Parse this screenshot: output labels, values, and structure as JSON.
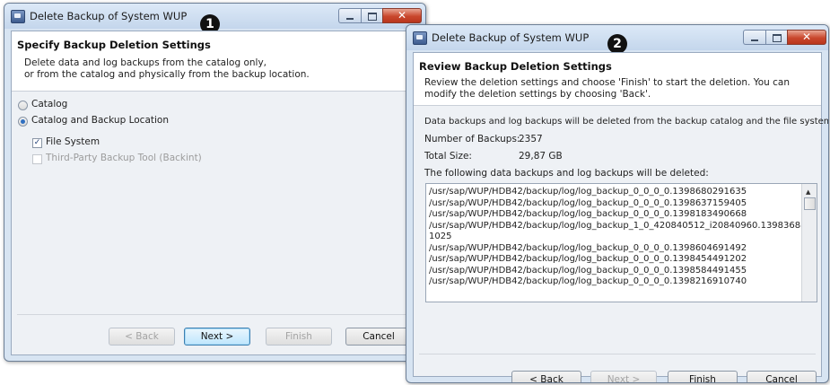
{
  "window1": {
    "title": "Delete Backup of System WUP",
    "badge": "1",
    "header_title": "Specify Backup Deletion Settings",
    "description": [
      "Delete data and log backups from the catalog only,",
      "or from the catalog and physically from the backup location."
    ],
    "radio_catalog": "Catalog",
    "radio_catalog_backup": "Catalog and Backup Location",
    "check_file_system": "File System",
    "check_third_party": "Third-Party Backup Tool (Backint)",
    "buttons": {
      "back": "< Back",
      "next": "Next >",
      "finish": "Finish",
      "cancel": "Cancel"
    }
  },
  "window2": {
    "title": "Delete Backup of System WUP",
    "badge": "2",
    "header_title": "Review Backup Deletion Settings",
    "description": [
      "Review the deletion settings and choose 'Finish' to start the deletion. You can",
      "modify the deletion settings by choosing 'Back'."
    ],
    "summary": "Data backups and log backups will be deleted from the backup catalog and the file system.",
    "num_backups_label": "Number of Backups:",
    "num_backups_value": "2357",
    "total_size_label": "Total Size:",
    "total_size_value": "29,87 GB",
    "list_heading": "The following data backups and log backups will be deleted:",
    "list_items": [
      "/usr/sap/WUP/HDB42/backup/log/log_backup_0_0_0_0.1398680291635",
      "/usr/sap/WUP/HDB42/backup/log/log_backup_0_0_0_0.1398637159405",
      "/usr/sap/WUP/HDB42/backup/log/log_backup_0_0_0_0.1398183490668",
      "/usr/sap/WUP/HDB42/backup/log/log_backup_1_0_420840512_i20840960.139836889",
      "1025",
      "/usr/sap/WUP/HDB42/backup/log/log_backup_0_0_0_0.1398604691492",
      "/usr/sap/WUP/HDB42/backup/log/log_backup_0_0_0_0.1398454491202",
      "/usr/sap/WUP/HDB42/backup/log/log_backup_0_0_0_0.1398584491455",
      "/usr/sap/WUP/HDB42/backup/log/log_backup_0_0_0_0.1398216910740"
    ],
    "buttons": {
      "back": "< Back",
      "next": "Next >",
      "finish": "Finish",
      "cancel": "Cancel"
    }
  }
}
